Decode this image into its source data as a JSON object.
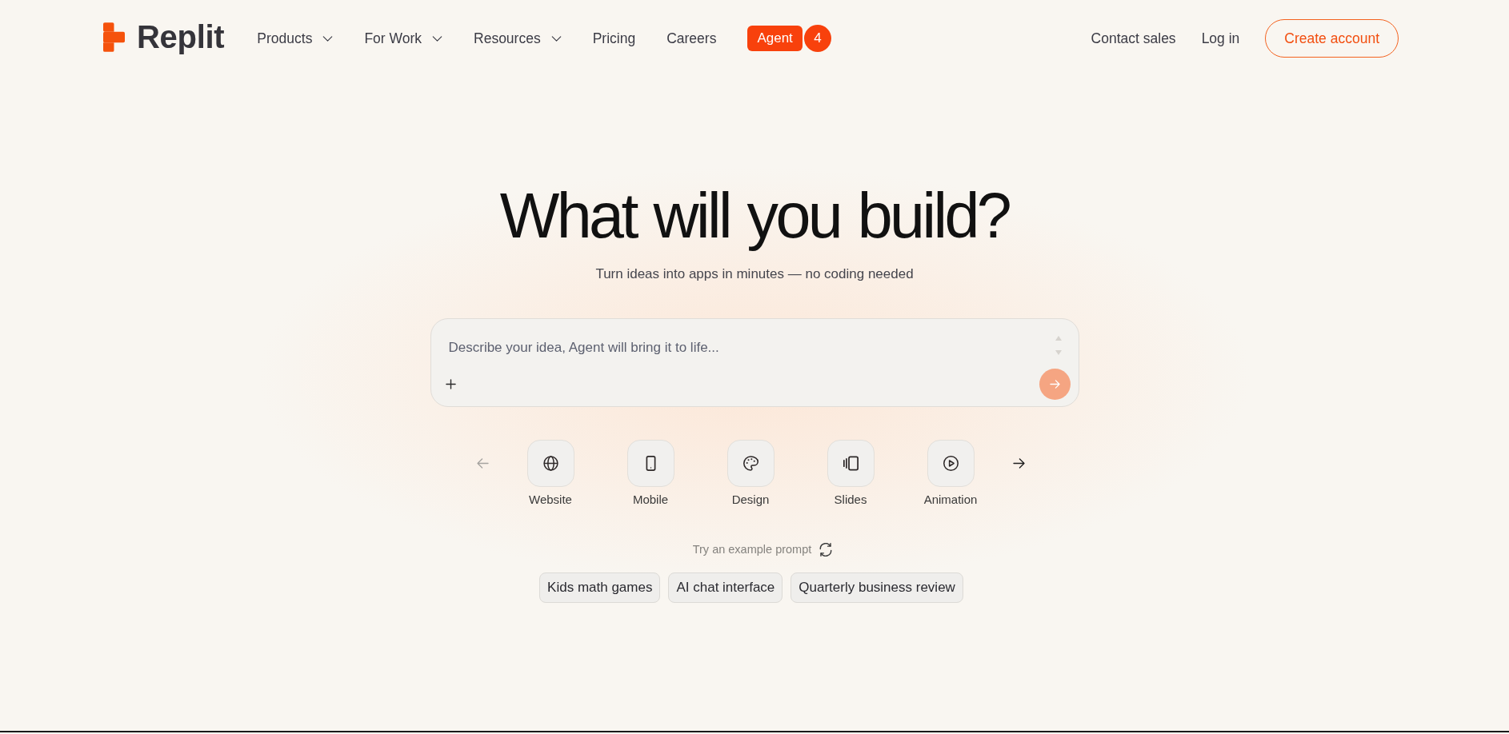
{
  "header": {
    "logo": {
      "text": "Replit"
    },
    "nav": [
      {
        "label": "Products",
        "dropdown": true
      },
      {
        "label": "For Work",
        "dropdown": true
      },
      {
        "label": "Resources",
        "dropdown": true
      },
      {
        "label": "Pricing",
        "dropdown": false
      },
      {
        "label": "Careers",
        "dropdown": false
      }
    ],
    "agent": {
      "label": "Agent",
      "badge": "4"
    },
    "actions": [
      {
        "label": "Contact sales",
        "kind": "link"
      },
      {
        "label": "Log in",
        "kind": "link"
      },
      {
        "label": "Create account",
        "kind": "outline"
      }
    ]
  },
  "hero": {
    "title": "What will you build?",
    "subtitle": "Turn ideas into apps in minutes — no coding needed"
  },
  "prompt": {
    "placeholder": "Describe your idea, Agent will bring it to life...",
    "send_disabled": true
  },
  "categories": {
    "prev_disabled": true,
    "next_disabled": false,
    "items": [
      {
        "label": "Website",
        "kind": "globe"
      },
      {
        "label": "Mobile",
        "kind": "phone"
      },
      {
        "label": "Design",
        "kind": "palette"
      },
      {
        "label": "Slides",
        "kind": "slides"
      },
      {
        "label": "Animation",
        "kind": "play"
      }
    ]
  },
  "examples": {
    "hint": "Try an example prompt",
    "chips": [
      "Kids math games",
      "AI chat interface",
      "Quarterly business review"
    ]
  }
}
